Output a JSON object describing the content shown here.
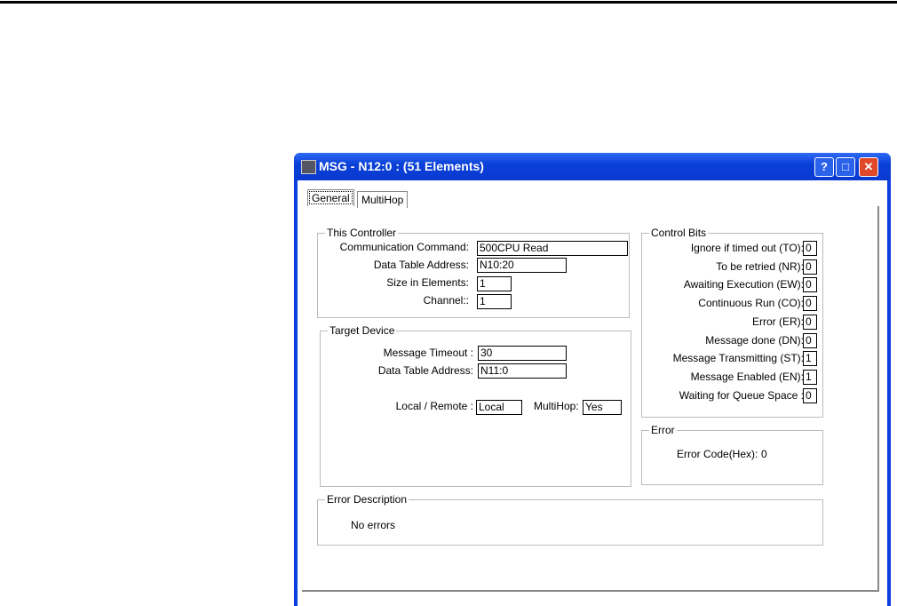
{
  "window": {
    "title": "MSG - N12:0 : (51 Elements)"
  },
  "tabs": [
    {
      "label": "General"
    },
    {
      "label": "MultiHop"
    }
  ],
  "this_controller": {
    "legend": "This Controller",
    "rows": [
      {
        "label": "Communication Command:",
        "value": "500CPU Read"
      },
      {
        "label": "Data Table Address:",
        "value": "N10:20"
      },
      {
        "label": "Size in Elements:",
        "value": "1"
      },
      {
        "label": "Channel::",
        "value": "1"
      }
    ]
  },
  "target_device": {
    "legend": "Target Device",
    "timeout_label": "Message Timeout :",
    "timeout_value": "30",
    "address_label": "Data Table Address:",
    "address_value": "N11:0",
    "local_remote_label": "Local / Remote :",
    "local_remote_value": "Local",
    "multihop_label": "MultiHop:",
    "multihop_value": "Yes"
  },
  "control_bits": {
    "legend": "Control Bits",
    "bits": [
      {
        "label": "Ignore if timed out (TO):",
        "value": "0"
      },
      {
        "label": "To be retried (NR):",
        "value": "0"
      },
      {
        "label": "Awaiting Execution (EW):",
        "value": "0"
      },
      {
        "label": "Continuous Run (CO):",
        "value": "0"
      },
      {
        "label": "Error (ER):",
        "value": "0"
      },
      {
        "label": "Message done (DN):",
        "value": "0"
      },
      {
        "label": "Message Transmitting (ST):",
        "value": "1"
      },
      {
        "label": "Message Enabled (EN):",
        "value": "1"
      },
      {
        "label": "Waiting for Queue Space :",
        "value": "0"
      }
    ]
  },
  "error": {
    "legend": "Error",
    "code_label": "Error Code(Hex):",
    "code_value": "0"
  },
  "error_description": {
    "legend": "Error Description",
    "text": "No errors"
  }
}
